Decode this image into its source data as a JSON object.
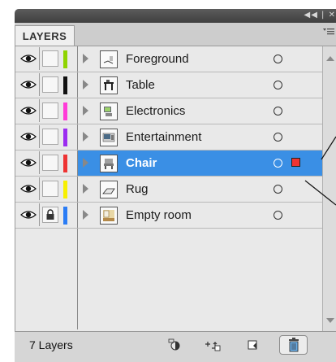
{
  "panel": {
    "title_controls": "◀◀ | ✕",
    "tab_label": "LAYERS",
    "menu_icon": "panel-menu-icon",
    "layer_count_label": "7 Layers"
  },
  "layers": [
    {
      "name": "Foreground",
      "color": "#8fd400",
      "selected": false,
      "locked": false,
      "thumb": "foreground"
    },
    {
      "name": "Table",
      "color": "#111111",
      "selected": false,
      "locked": false,
      "thumb": "table"
    },
    {
      "name": "Electronics",
      "color": "#ff3cd8",
      "selected": false,
      "locked": false,
      "thumb": "electronics"
    },
    {
      "name": "Entertainment",
      "color": "#9b2cf0",
      "selected": false,
      "locked": false,
      "thumb": "entertainment"
    },
    {
      "name": "Chair",
      "color": "#ee3333",
      "selected": true,
      "locked": false,
      "thumb": "chair"
    },
    {
      "name": "Rug",
      "color": "#f7f000",
      "selected": false,
      "locked": false,
      "thumb": "rug"
    },
    {
      "name": "Empty room",
      "color": "#2a7cf5",
      "selected": false,
      "locked": true,
      "thumb": "empty-room"
    }
  ],
  "footer_icons": [
    "make-clipping-mask-icon",
    "create-sublayer-icon",
    "new-layer-icon",
    "trash-icon"
  ],
  "colors": {
    "selection": "#3a8fe5",
    "selection_art": "#ee3333"
  }
}
